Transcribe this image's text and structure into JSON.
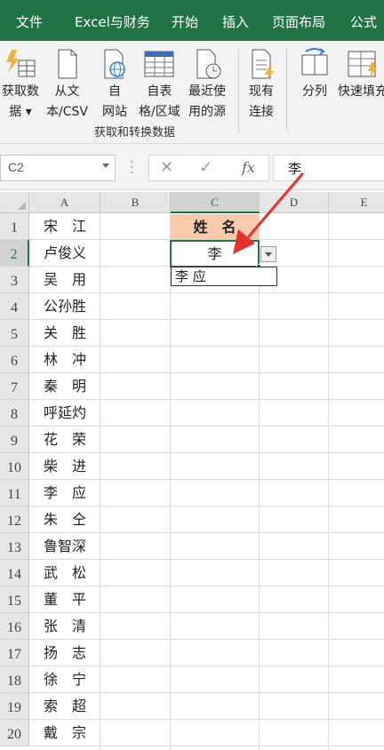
{
  "ribbon_tabs": [
    "文件",
    "Excel与财务",
    "开始",
    "插入",
    "页面布局",
    "公式"
  ],
  "ribbon_buttons": {
    "get_data": [
      "获取数",
      "据 ▾"
    ],
    "from_text": [
      "从文",
      "本/CSV"
    ],
    "from_web": [
      "自",
      "网站"
    ],
    "from_table": [
      "自表",
      "格/区域"
    ],
    "recent_sources": [
      "最近使",
      "用的源"
    ],
    "existing_connections": [
      "现有",
      "连接"
    ],
    "split_column": "分列",
    "flash_fill": "快速填充"
  },
  "group_label": "获取和转换数据",
  "formula_bar": {
    "name_box": "C2",
    "cancel_glyph": "✕",
    "enter_glyph": "✓",
    "fx_label": "fx",
    "formula_value": "李"
  },
  "columns": [
    "A",
    "B",
    "C",
    "D",
    "E"
  ],
  "rows": [
    "1",
    "2",
    "3",
    "4",
    "5",
    "6",
    "7",
    "8",
    "9",
    "10",
    "11",
    "12",
    "13",
    "14",
    "15",
    "16",
    "17",
    "18",
    "19",
    "20"
  ],
  "column_a": [
    "宋　江",
    "卢俊义",
    "吴　用",
    "公孙胜",
    "关　胜",
    "林　冲",
    "秦　明",
    "呼延灼",
    "花　荣",
    "柴　进",
    "李　应",
    "朱　仝",
    "鲁智深",
    "武　松",
    "董　平",
    "张　清",
    "扬　志",
    "徐　宁",
    "索　超",
    "戴　宗"
  ],
  "c1_header": "姓　名",
  "c2_value": "李",
  "autocomplete_option": "李 应",
  "colors": {
    "tab_bar": "#217346",
    "header_fill": "#f8cbad",
    "selection_border": "#217346",
    "arrow": "#e8312a"
  }
}
